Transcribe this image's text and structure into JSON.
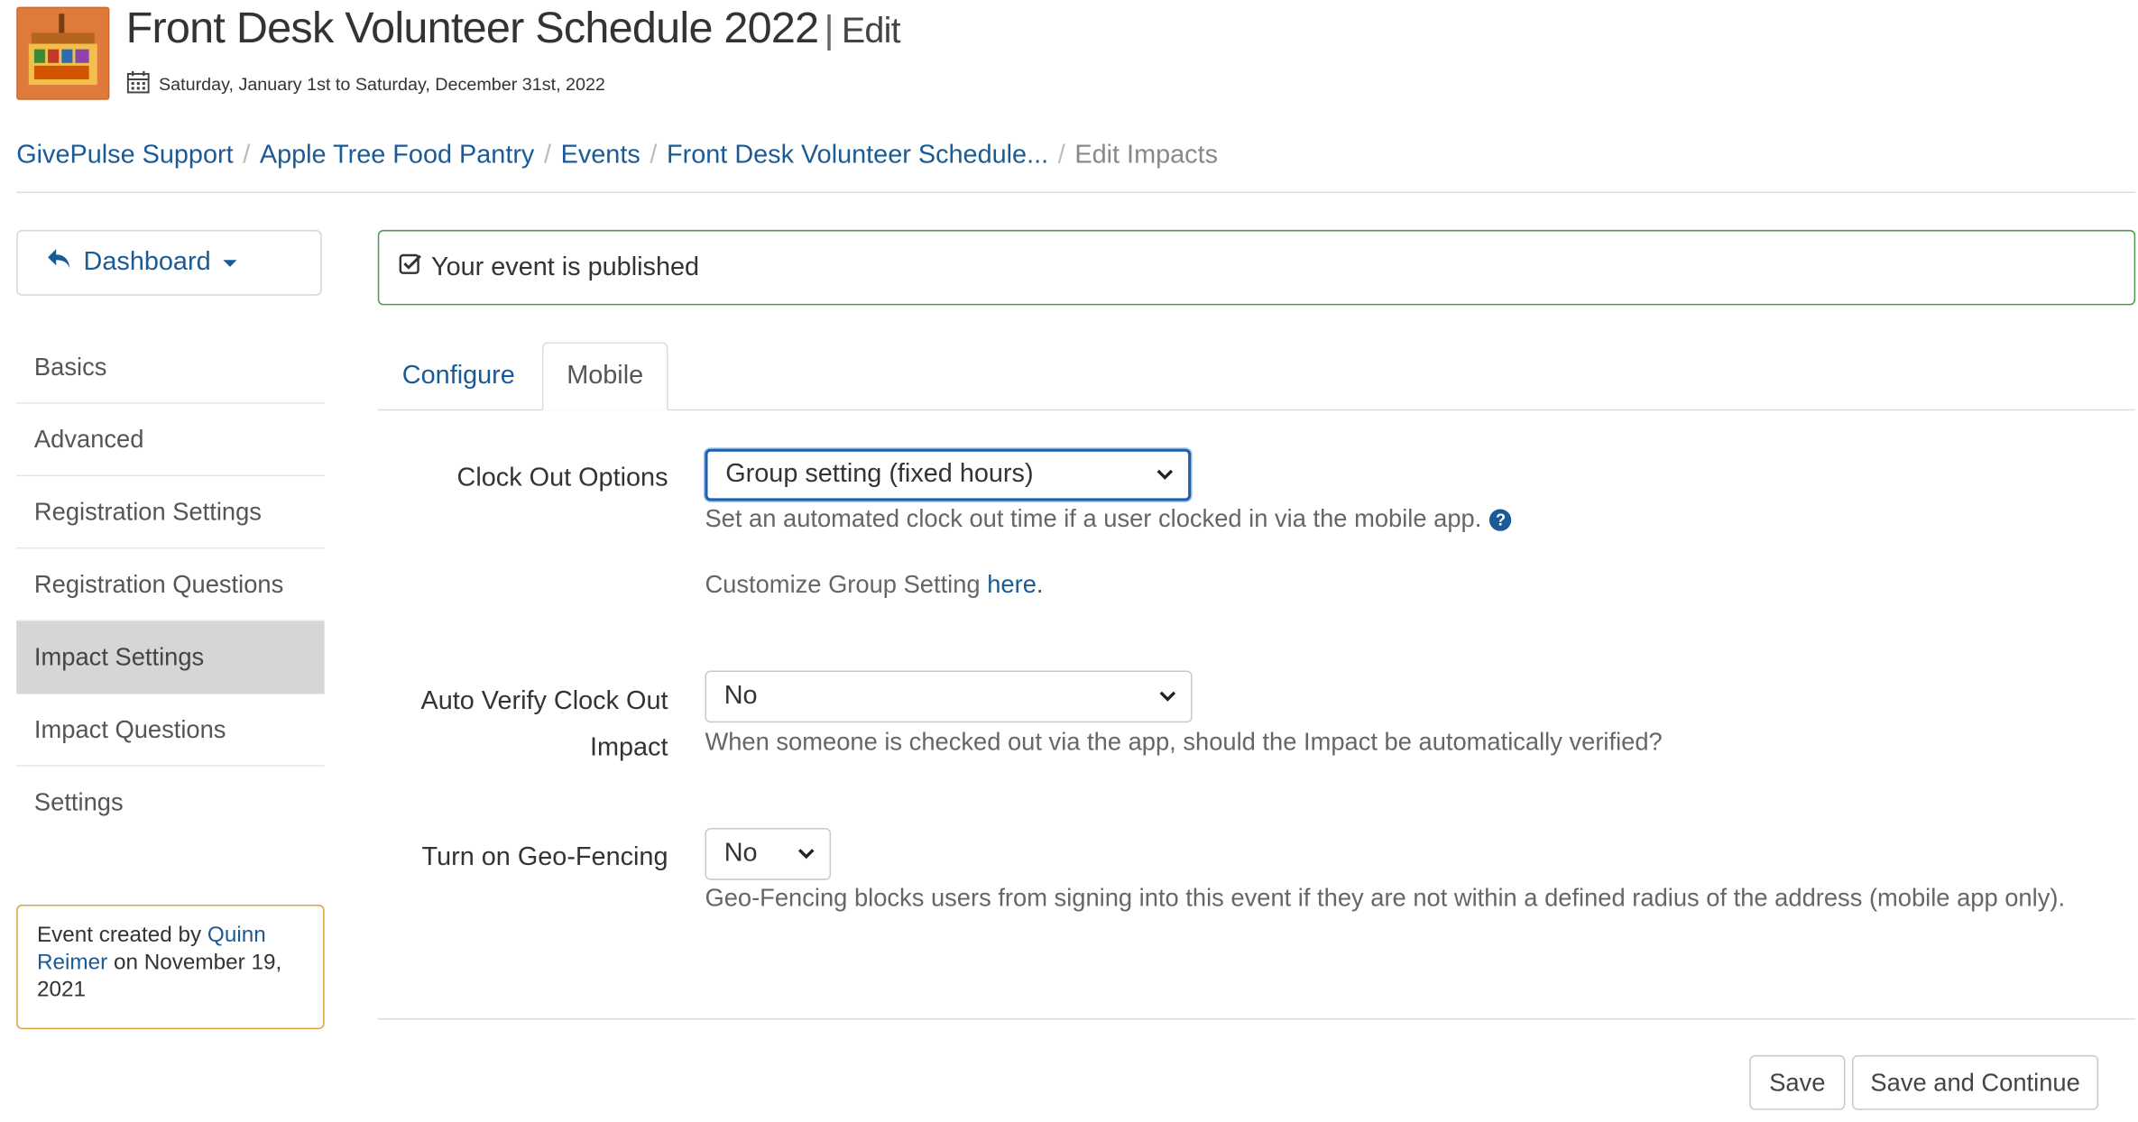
{
  "header": {
    "title": "Front Desk Volunteer Schedule 2022",
    "separator": "|",
    "mode": "Edit",
    "date_range": "Saturday, January 1st to Saturday, December 31st, 2022"
  },
  "breadcrumb": [
    {
      "label": "GivePulse Support"
    },
    {
      "label": "Apple Tree Food Pantry"
    },
    {
      "label": "Events"
    },
    {
      "label": "Front Desk Volunteer Schedule..."
    },
    {
      "label": "Edit Impacts"
    }
  ],
  "sidebar": {
    "dashboard_label": "Dashboard",
    "items": [
      {
        "label": "Basics"
      },
      {
        "label": "Advanced"
      },
      {
        "label": "Registration Settings"
      },
      {
        "label": "Registration Questions"
      },
      {
        "label": "Impact Settings",
        "active": true
      },
      {
        "label": "Impact Questions"
      },
      {
        "label": "Settings"
      }
    ],
    "created": {
      "prefix": "Event created by",
      "author": "Quinn Reimer",
      "suffix": "on November 19, 2021"
    }
  },
  "alert": {
    "text": "Your event is published"
  },
  "tabs": [
    {
      "label": "Configure"
    },
    {
      "label": "Mobile",
      "active": true
    }
  ],
  "form": {
    "clock_out": {
      "label": "Clock Out Options",
      "value": "Group setting (fixed hours)",
      "help": "Set an automated clock out time if a user clocked in via the mobile app.",
      "customize_prefix": "Customize Group Setting",
      "customize_link": "here."
    },
    "auto_verify": {
      "label_line1": "Auto Verify Clock Out",
      "label_line2": "Impact",
      "value": "No",
      "help": "When someone is checked out via the app, should the Impact be automatically verified?"
    },
    "geo_fencing": {
      "label": "Turn on Geo-Fencing",
      "value": "No",
      "help": "Geo-Fencing blocks users from signing into this event if they are not within a defined radius of the address (mobile app only)."
    }
  },
  "actions": {
    "save": "Save",
    "save_continue": "Save and Continue"
  },
  "colors": {
    "link": "#1a5a96",
    "alert_border": "#4f9a4f",
    "created_border": "#d9a441",
    "active_sidebar": "#d6d6d6",
    "logo": "#e07a3b"
  }
}
